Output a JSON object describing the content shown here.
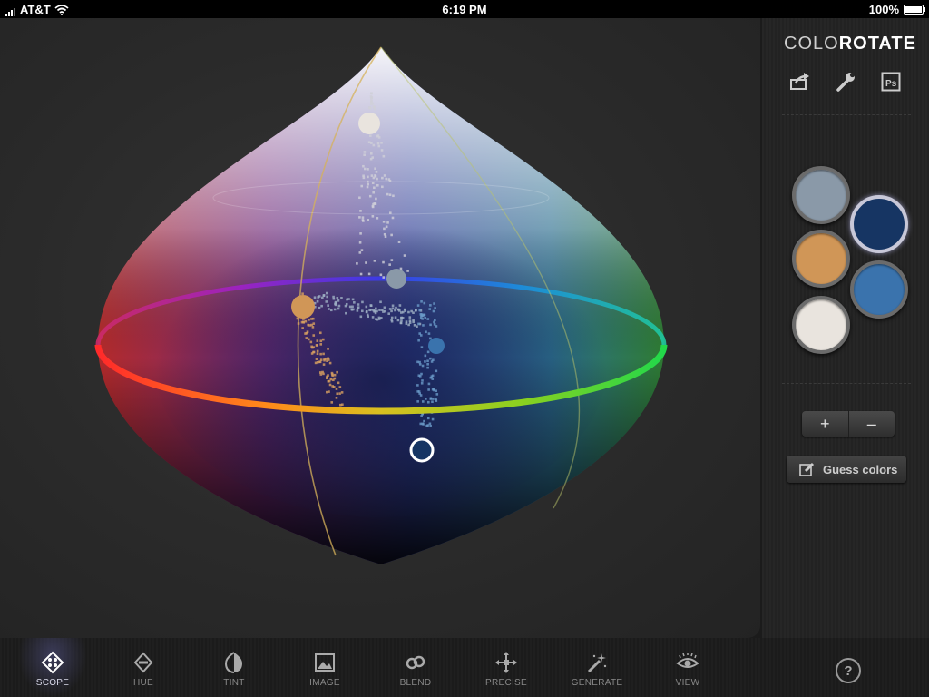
{
  "status": {
    "carrier": "AT&T",
    "time": "6:19 PM",
    "battery": "100%"
  },
  "app": {
    "logo_part1": "COLO",
    "logo_part2": "ROTATE"
  },
  "palette": [
    {
      "name": "slate-gray",
      "color": "#8a99a8",
      "selected": false
    },
    {
      "name": "navy",
      "color": "#163563",
      "selected": true
    },
    {
      "name": "tan-orange",
      "color": "#d09657",
      "selected": false
    },
    {
      "name": "steel-blue",
      "color": "#3a73ad",
      "selected": false
    },
    {
      "name": "off-white",
      "color": "#e9e4de",
      "selected": false
    }
  ],
  "controls": {
    "plus": "+",
    "minus": "–",
    "guess": "Guess colors"
  },
  "tabs": [
    {
      "label": "SCOPE",
      "icon": "scope-icon",
      "active": true
    },
    {
      "label": "HUE",
      "icon": "hue-icon",
      "active": false
    },
    {
      "label": "TINT",
      "icon": "tint-icon",
      "active": false
    },
    {
      "label": "IMAGE",
      "icon": "image-icon",
      "active": false
    },
    {
      "label": "BLEND",
      "icon": "blend-icon",
      "active": false
    },
    {
      "label": "PRECISE",
      "icon": "precise-icon",
      "active": false
    },
    {
      "label": "GENERATE",
      "icon": "generate-icon",
      "active": false
    },
    {
      "label": "VIEW",
      "icon": "view-icon",
      "active": false
    }
  ],
  "help": "?"
}
